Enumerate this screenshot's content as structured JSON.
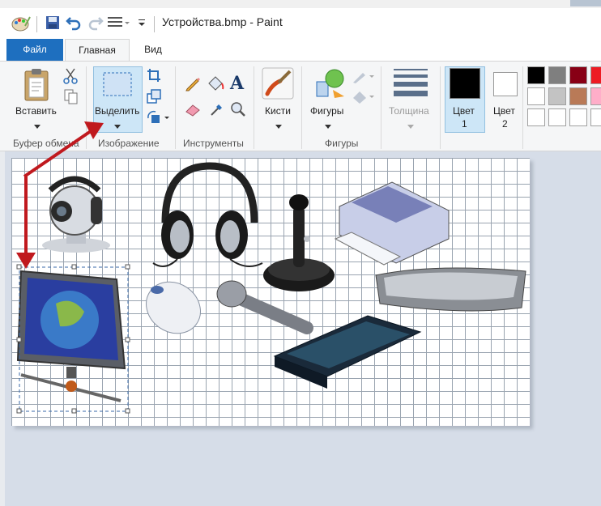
{
  "window": {
    "title": "Устройства.bmp - Paint"
  },
  "tabs": {
    "file": "Файл",
    "home": "Главная",
    "view": "Вид"
  },
  "ribbon": {
    "clipboard": {
      "paste": "Вставить",
      "group": "Буфер обмена"
    },
    "image": {
      "select": "Выделить",
      "group": "Изображение"
    },
    "tools": {
      "group": "Инструменты"
    },
    "brushes": {
      "label": "Кисти"
    },
    "shapes": {
      "label": "Фигуры",
      "group": "Фигуры"
    },
    "size": {
      "label": "Толщина"
    },
    "color1": {
      "label_a": "Цвет",
      "label_b": "1"
    },
    "color2": {
      "label_a": "Цвет",
      "label_b": "2"
    }
  },
  "palette": [
    "#000000",
    "#7f7f7f",
    "#880015",
    "#ed1c24",
    "#ffffff",
    "#c3c3c3",
    "#b97a57",
    "#ffaec9",
    "#ffffff",
    "#ffffff",
    "#ffffff",
    "#ffffff"
  ],
  "colors": {
    "accent": "#1e6fbf",
    "arrow": "#c0191e",
    "selection_bg": "#cde6f7"
  }
}
